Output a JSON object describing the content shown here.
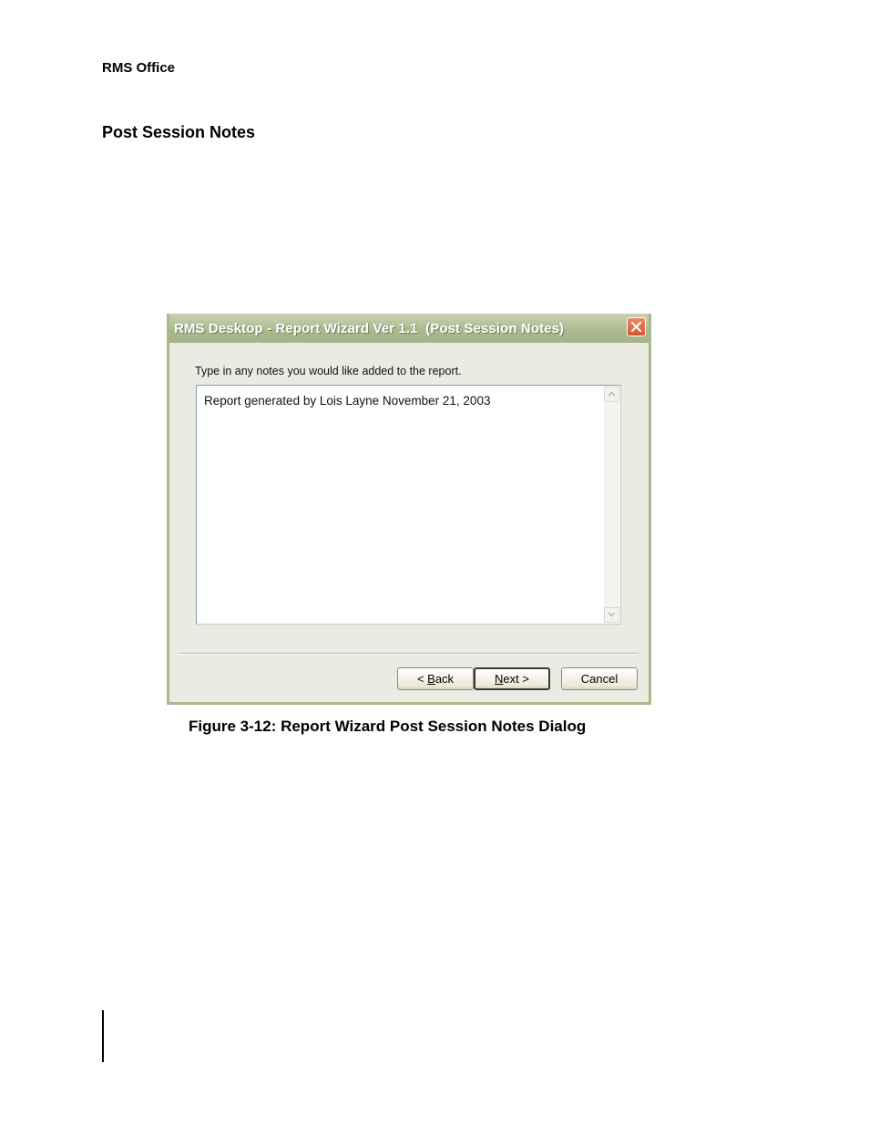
{
  "page": {
    "running_header": "RMS Office",
    "section_title": "Post Session Notes",
    "figure_caption": "Figure 3-12: Report Wizard Post Session Notes Dialog"
  },
  "dialog": {
    "title": "RMS Desktop - Report Wizard Ver 1.1  (Post Session Notes)",
    "instruction": "Type in any notes you would like added to the report.",
    "notes_text": "Report generated by Lois Layne November 21, 2003",
    "buttons": {
      "back": {
        "prefix": "< ",
        "mnemonic": "B",
        "rest": "ack"
      },
      "next": {
        "mnemonic": "N",
        "rest": "ext >"
      },
      "cancel": "Cancel"
    }
  },
  "icons": {
    "close": "close-icon",
    "scroll_up": "chevron-up-icon",
    "scroll_down": "chevron-down-icon"
  },
  "colors": {
    "title_bar": "#aab88e",
    "close_button": "#d2562e",
    "dialog_face": "#ecebe3"
  }
}
